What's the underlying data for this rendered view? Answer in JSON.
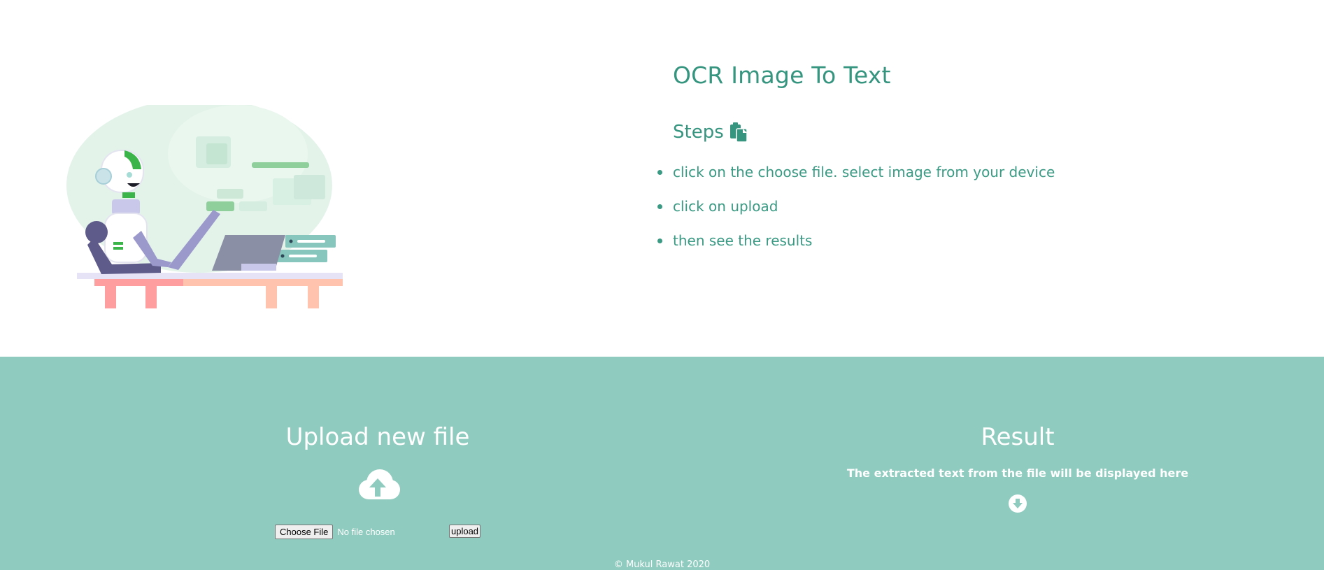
{
  "hero": {
    "title": "OCR Image To Text",
    "steps_heading": "Steps",
    "steps_icon": "clipboard-copy-icon",
    "steps": [
      "click on the choose file. select image from your device",
      "click on upload",
      "then see the results"
    ],
    "illustration": "robot-at-laptop-illustration"
  },
  "upload": {
    "title": "Upload new file",
    "icon": "cloud-upload-icon",
    "choose_label": "Choose File",
    "no_file_text": "No file chosen",
    "upload_label": "upload"
  },
  "result": {
    "title": "Result",
    "description": "The extracted text from the file will be displayed here",
    "icon": "arrow-circle-down-icon"
  },
  "footer": {
    "text": "© Mukul Rawat 2020"
  },
  "colors": {
    "accent": "#36957f",
    "band": "#8fcbbe",
    "white": "#ffffff"
  }
}
